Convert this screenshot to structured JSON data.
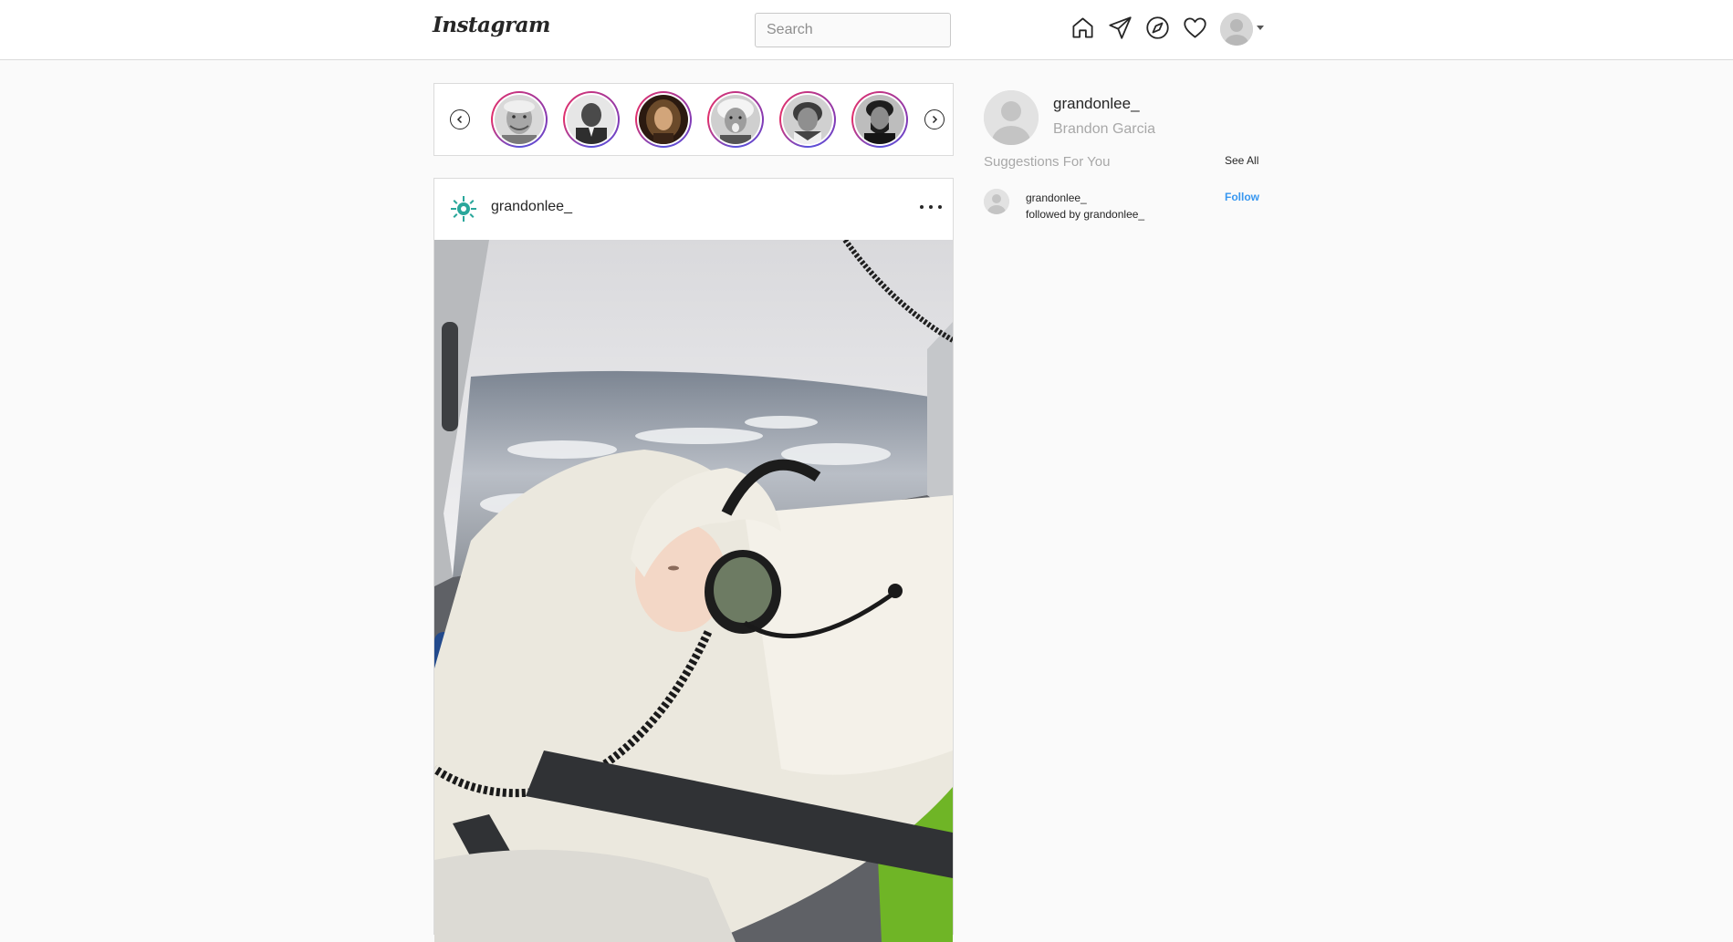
{
  "nav": {
    "logo": "Instagram",
    "search_placeholder": "Search",
    "search_value": "",
    "icons": [
      "home-icon",
      "direct-icon",
      "explore-icon",
      "activity-icon"
    ]
  },
  "stories": {
    "items": [
      {
        "name": "story-1",
        "icon": "portrait"
      },
      {
        "name": "story-2",
        "icon": "portrait"
      },
      {
        "name": "story-3",
        "icon": "portrait"
      },
      {
        "name": "story-4",
        "icon": "portrait"
      },
      {
        "name": "story-5",
        "icon": "portrait"
      },
      {
        "name": "story-6",
        "icon": "portrait"
      }
    ]
  },
  "post": {
    "username": "grandonlee_"
  },
  "sidebar": {
    "username": "grandonlee_",
    "full_name": "Brandon Garcia",
    "suggestions_title": "Suggestions For You",
    "see_all": "See All",
    "suggestions": [
      {
        "username": "grandonlee_",
        "subtitle": "followed by grandonlee_",
        "action": "Follow"
      }
    ]
  },
  "colors": {
    "accent": "#3897f0",
    "story_ring": "#c13584",
    "border": "#dbdbdb",
    "background": "#fafafa"
  }
}
